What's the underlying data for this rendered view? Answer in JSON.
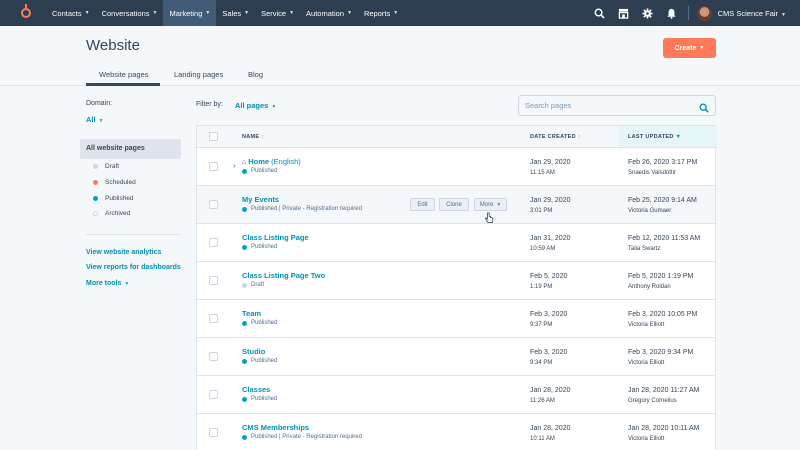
{
  "topnav": {
    "items": [
      {
        "label": "Contacts"
      },
      {
        "label": "Conversations"
      },
      {
        "label": "Marketing"
      },
      {
        "label": "Sales"
      },
      {
        "label": "Service"
      },
      {
        "label": "Automation"
      },
      {
        "label": "Reports"
      }
    ],
    "active": "Marketing",
    "account_name": "CMS Science Fair",
    "icons": [
      "search-icon",
      "marketplace-icon",
      "settings-icon",
      "notifications-icon"
    ]
  },
  "header": {
    "title": "Website",
    "create_label": "Create",
    "tabs": [
      {
        "label": "Website pages"
      },
      {
        "label": "Landing pages"
      },
      {
        "label": "Blog"
      }
    ]
  },
  "sidebar": {
    "domain_label": "Domain:",
    "domain_value": "All",
    "active_view": "All website pages",
    "filters": [
      {
        "label": "Draft",
        "color": "#cbd6e2"
      },
      {
        "label": "Scheduled",
        "color": "#ff7a59"
      },
      {
        "label": "Published",
        "color": "#00a4bd"
      },
      {
        "label": "Archived",
        "color": "#ffffff"
      }
    ],
    "links": [
      {
        "label": "View website analytics"
      },
      {
        "label": "View reports for dashboards"
      },
      {
        "label": "More tools"
      }
    ]
  },
  "toolbar": {
    "filter_label": "Filter by:",
    "filter_value": "All pages",
    "search_placeholder": "Search pages"
  },
  "table": {
    "columns": {
      "name": "NAME",
      "created": "DATE CREATED",
      "updated": "LAST UPDATED"
    },
    "hover_actions": {
      "edit": "Edit",
      "clone": "Clone",
      "more": "More"
    },
    "rows": [
      {
        "name": "Home",
        "lang": "(English)",
        "status": "Published",
        "status_color": "#00a4bd",
        "created_date": "Jan 29, 2020",
        "created_time": "11:15 AM",
        "updated": "Feb 26, 2020 3:17 PM",
        "user": "Snaedis Valsdottir"
      },
      {
        "name": "My Events",
        "lang": "",
        "status": "Published | Private - Registration required",
        "status_color": "#00a4bd",
        "created_date": "Jan 29, 2020",
        "created_time": "3:01 PM",
        "updated": "Feb 25, 2020 9:14 AM",
        "user": "Victoria Gumaer"
      },
      {
        "name": "Class Listing Page",
        "lang": "",
        "status": "Published",
        "status_color": "#00a4bd",
        "created_date": "Jan 31, 2020",
        "created_time": "10:59 AM",
        "updated": "Feb 12, 2020 11:53 AM",
        "user": "Talia Swartz"
      },
      {
        "name": "Class Listing Page Two",
        "lang": "",
        "status": "Draft",
        "status_color": "#cbd6e2",
        "created_date": "Feb 5, 2020",
        "created_time": "1:19 PM",
        "updated": "Feb 5, 2020 1:19 PM",
        "user": "Anthony Roldan"
      },
      {
        "name": "Team",
        "lang": "",
        "status": "Published",
        "status_color": "#00a4bd",
        "created_date": "Feb 3, 2020",
        "created_time": "9:37 PM",
        "updated": "Feb 3, 2020 10:05 PM",
        "user": "Victoria Elliott"
      },
      {
        "name": "Studio",
        "lang": "",
        "status": "Published",
        "status_color": "#00a4bd",
        "created_date": "Feb 3, 2020",
        "created_time": "9:34 PM",
        "updated": "Feb 3, 2020 9:34 PM",
        "user": "Victoria Elliott"
      },
      {
        "name": "Classes",
        "lang": "",
        "status": "Published",
        "status_color": "#00a4bd",
        "created_date": "Jan 28, 2020",
        "created_time": "11:26 AM",
        "updated": "Jan 28, 2020 11:27 AM",
        "user": "Gregory Cornelius"
      },
      {
        "name": "CMS Memberships",
        "lang": "",
        "status": "Published | Private - Registration required",
        "status_color": "#00a4bd",
        "created_date": "Jan 28, 2020",
        "created_time": "10:11 AM",
        "updated": "Jan 28, 2020 10:11 AM",
        "user": "Victoria Elliott"
      }
    ]
  }
}
